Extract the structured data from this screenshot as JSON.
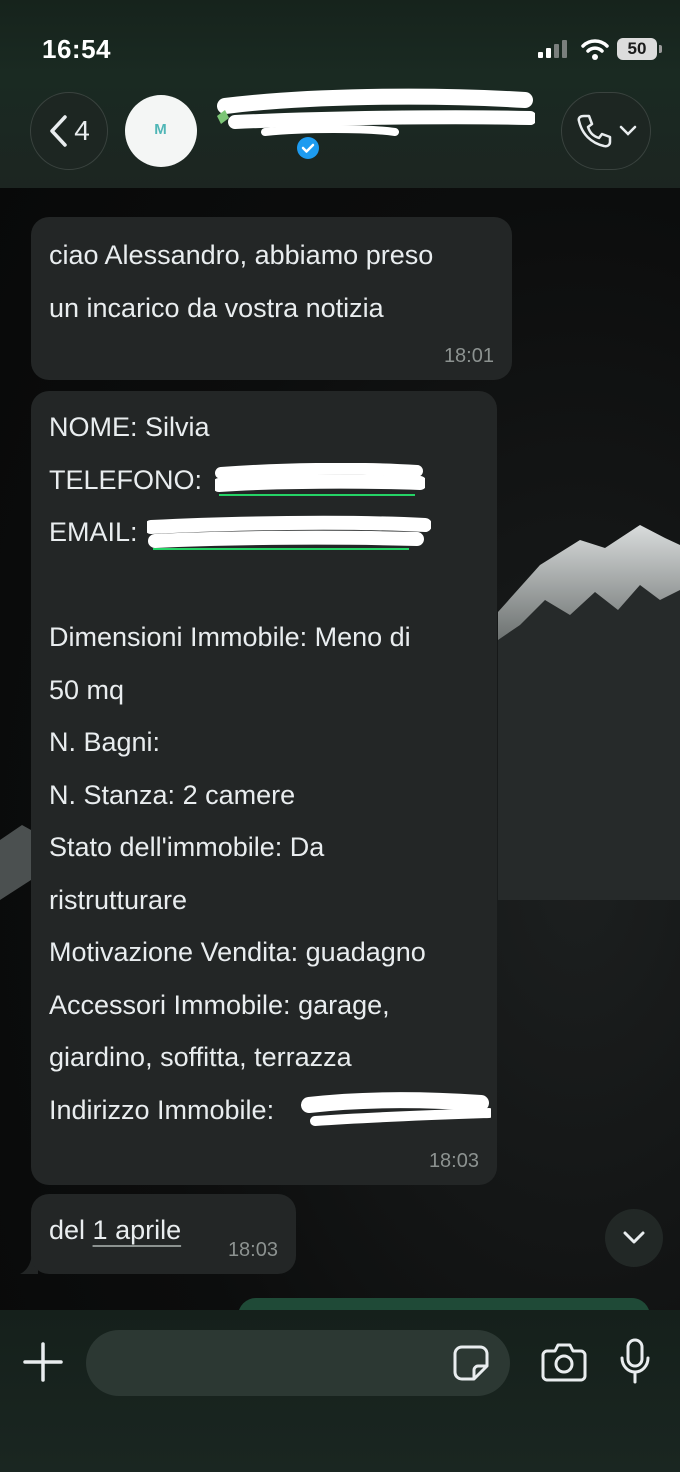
{
  "status_bar": {
    "time": "16:54",
    "battery": "50"
  },
  "header": {
    "back_count": "4",
    "avatar_text": "M",
    "contact_name": "[redacted]"
  },
  "messages": [
    {
      "direction": "incoming",
      "lines": [
        "ciao Alessandro, abbiamo preso",
        "un incarico da vostra notizia"
      ],
      "time": "18:01"
    },
    {
      "direction": "incoming",
      "lines": [
        "NOME: Silvia",
        "TELEFONO:",
        "EMAIL:",
        "",
        "Dimensioni Immobile: Meno di",
        "50 mq",
        "N. Bagni:",
        "N. Stanza: 2 camere",
        "Stato dell'immobile: Da",
        "ristrutturare",
        "Motivazione Vendita: guadagno",
        "Accessori Immobile: garage,",
        "giardino, soffitta, terrazza",
        "Indirizzo Immobile:"
      ],
      "time": "18:03"
    },
    {
      "direction": "incoming",
      "prefix": "del ",
      "link": "1 aprile",
      "time": "18:03"
    }
  ],
  "composer": {
    "placeholder": ""
  },
  "colors": {
    "bubble_incoming": "#232626",
    "header_bg": "#1a2a22",
    "verified": "#1d9bf0",
    "link_underline": "#25d366"
  },
  "icons": [
    "back-chevron-icon",
    "verified-badge-icon",
    "phone-icon",
    "chevron-down-icon",
    "plus-icon",
    "sticker-icon",
    "camera-icon",
    "microphone-icon",
    "signal-icon",
    "wifi-icon",
    "battery-icon"
  ]
}
